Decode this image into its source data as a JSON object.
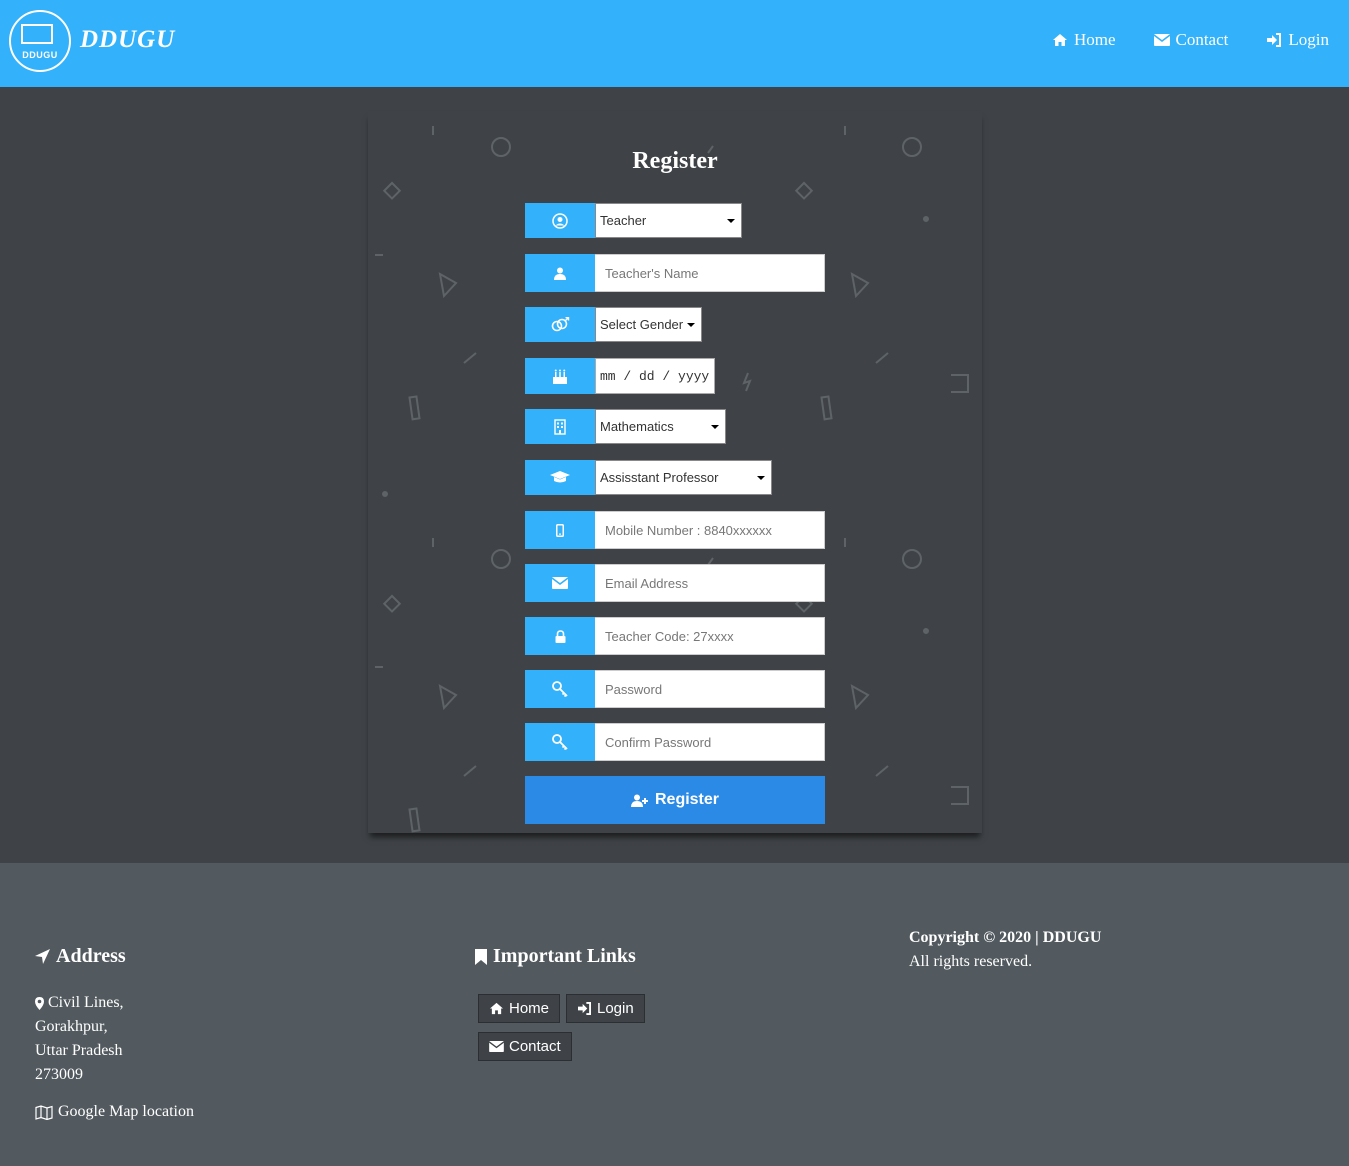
{
  "header": {
    "logo_text": "DDUGU",
    "brand": "DDUGU",
    "nav": [
      {
        "label": "Home",
        "icon": "home-icon"
      },
      {
        "label": "Contact",
        "icon": "envelope-icon"
      },
      {
        "label": "Login",
        "icon": "sign-in-icon"
      }
    ]
  },
  "form": {
    "title": "Register",
    "role": {
      "value": "Teacher",
      "icon": "user-circle-icon"
    },
    "name": {
      "placeholder": "Teacher's Name",
      "icon": "user-icon"
    },
    "gender": {
      "value": "Select Gender",
      "icon": "genderless-icon"
    },
    "dob": {
      "placeholder": "mm / dd / yyyy",
      "icon": "birthday-cake-icon"
    },
    "department": {
      "value": "Mathematics",
      "icon": "building-icon"
    },
    "designation": {
      "value": "Assisstant Professor",
      "icon": "graduation-cap-icon"
    },
    "mobile": {
      "placeholder": "Mobile Number : 8840xxxxxx",
      "icon": "mobile-icon"
    },
    "email": {
      "placeholder": "Email Address",
      "icon": "envelope-icon"
    },
    "code": {
      "placeholder": "Teacher Code: 27xxxx",
      "icon": "lock-icon"
    },
    "password": {
      "placeholder": "Password",
      "icon": "key-icon"
    },
    "confirm": {
      "placeholder": "Confirm Password",
      "icon": "key-icon"
    },
    "submit_label": "Register"
  },
  "footer": {
    "address_heading": "Address",
    "address_lines": [
      "Civil Lines,",
      "Gorakhpur,",
      "Uttar Pradesh",
      "273009"
    ],
    "map_label": "Google Map location",
    "links_heading": "Important Links",
    "links": {
      "home": "Home",
      "login": "Login",
      "contact": "Contact"
    },
    "copyright": "Copyright © 2020 | DDUGU",
    "rights": "All rights reserved."
  },
  "colors": {
    "accent": "#33b2fb",
    "button": "#2b8ae6",
    "background": "#3f4347",
    "footer": "#525a5f"
  }
}
